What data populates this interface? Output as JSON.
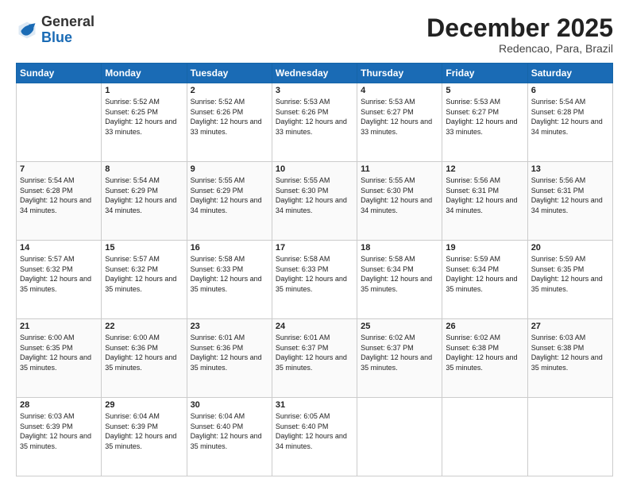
{
  "logo": {
    "general": "General",
    "blue": "Blue"
  },
  "header": {
    "title": "December 2025",
    "subtitle": "Redencao, Para, Brazil"
  },
  "days_of_week": [
    "Sunday",
    "Monday",
    "Tuesday",
    "Wednesday",
    "Thursday",
    "Friday",
    "Saturday"
  ],
  "weeks": [
    [
      {
        "day": "",
        "sunrise": "",
        "sunset": "",
        "daylight": ""
      },
      {
        "day": "1",
        "sunrise": "Sunrise: 5:52 AM",
        "sunset": "Sunset: 6:25 PM",
        "daylight": "Daylight: 12 hours and 33 minutes."
      },
      {
        "day": "2",
        "sunrise": "Sunrise: 5:52 AM",
        "sunset": "Sunset: 6:26 PM",
        "daylight": "Daylight: 12 hours and 33 minutes."
      },
      {
        "day": "3",
        "sunrise": "Sunrise: 5:53 AM",
        "sunset": "Sunset: 6:26 PM",
        "daylight": "Daylight: 12 hours and 33 minutes."
      },
      {
        "day": "4",
        "sunrise": "Sunrise: 5:53 AM",
        "sunset": "Sunset: 6:27 PM",
        "daylight": "Daylight: 12 hours and 33 minutes."
      },
      {
        "day": "5",
        "sunrise": "Sunrise: 5:53 AM",
        "sunset": "Sunset: 6:27 PM",
        "daylight": "Daylight: 12 hours and 33 minutes."
      },
      {
        "day": "6",
        "sunrise": "Sunrise: 5:54 AM",
        "sunset": "Sunset: 6:28 PM",
        "daylight": "Daylight: 12 hours and 34 minutes."
      }
    ],
    [
      {
        "day": "7",
        "sunrise": "Sunrise: 5:54 AM",
        "sunset": "Sunset: 6:28 PM",
        "daylight": "Daylight: 12 hours and 34 minutes."
      },
      {
        "day": "8",
        "sunrise": "Sunrise: 5:54 AM",
        "sunset": "Sunset: 6:29 PM",
        "daylight": "Daylight: 12 hours and 34 minutes."
      },
      {
        "day": "9",
        "sunrise": "Sunrise: 5:55 AM",
        "sunset": "Sunset: 6:29 PM",
        "daylight": "Daylight: 12 hours and 34 minutes."
      },
      {
        "day": "10",
        "sunrise": "Sunrise: 5:55 AM",
        "sunset": "Sunset: 6:30 PM",
        "daylight": "Daylight: 12 hours and 34 minutes."
      },
      {
        "day": "11",
        "sunrise": "Sunrise: 5:55 AM",
        "sunset": "Sunset: 6:30 PM",
        "daylight": "Daylight: 12 hours and 34 minutes."
      },
      {
        "day": "12",
        "sunrise": "Sunrise: 5:56 AM",
        "sunset": "Sunset: 6:31 PM",
        "daylight": "Daylight: 12 hours and 34 minutes."
      },
      {
        "day": "13",
        "sunrise": "Sunrise: 5:56 AM",
        "sunset": "Sunset: 6:31 PM",
        "daylight": "Daylight: 12 hours and 34 minutes."
      }
    ],
    [
      {
        "day": "14",
        "sunrise": "Sunrise: 5:57 AM",
        "sunset": "Sunset: 6:32 PM",
        "daylight": "Daylight: 12 hours and 35 minutes."
      },
      {
        "day": "15",
        "sunrise": "Sunrise: 5:57 AM",
        "sunset": "Sunset: 6:32 PM",
        "daylight": "Daylight: 12 hours and 35 minutes."
      },
      {
        "day": "16",
        "sunrise": "Sunrise: 5:58 AM",
        "sunset": "Sunset: 6:33 PM",
        "daylight": "Daylight: 12 hours and 35 minutes."
      },
      {
        "day": "17",
        "sunrise": "Sunrise: 5:58 AM",
        "sunset": "Sunset: 6:33 PM",
        "daylight": "Daylight: 12 hours and 35 minutes."
      },
      {
        "day": "18",
        "sunrise": "Sunrise: 5:58 AM",
        "sunset": "Sunset: 6:34 PM",
        "daylight": "Daylight: 12 hours and 35 minutes."
      },
      {
        "day": "19",
        "sunrise": "Sunrise: 5:59 AM",
        "sunset": "Sunset: 6:34 PM",
        "daylight": "Daylight: 12 hours and 35 minutes."
      },
      {
        "day": "20",
        "sunrise": "Sunrise: 5:59 AM",
        "sunset": "Sunset: 6:35 PM",
        "daylight": "Daylight: 12 hours and 35 minutes."
      }
    ],
    [
      {
        "day": "21",
        "sunrise": "Sunrise: 6:00 AM",
        "sunset": "Sunset: 6:35 PM",
        "daylight": "Daylight: 12 hours and 35 minutes."
      },
      {
        "day": "22",
        "sunrise": "Sunrise: 6:00 AM",
        "sunset": "Sunset: 6:36 PM",
        "daylight": "Daylight: 12 hours and 35 minutes."
      },
      {
        "day": "23",
        "sunrise": "Sunrise: 6:01 AM",
        "sunset": "Sunset: 6:36 PM",
        "daylight": "Daylight: 12 hours and 35 minutes."
      },
      {
        "day": "24",
        "sunrise": "Sunrise: 6:01 AM",
        "sunset": "Sunset: 6:37 PM",
        "daylight": "Daylight: 12 hours and 35 minutes."
      },
      {
        "day": "25",
        "sunrise": "Sunrise: 6:02 AM",
        "sunset": "Sunset: 6:37 PM",
        "daylight": "Daylight: 12 hours and 35 minutes."
      },
      {
        "day": "26",
        "sunrise": "Sunrise: 6:02 AM",
        "sunset": "Sunset: 6:38 PM",
        "daylight": "Daylight: 12 hours and 35 minutes."
      },
      {
        "day": "27",
        "sunrise": "Sunrise: 6:03 AM",
        "sunset": "Sunset: 6:38 PM",
        "daylight": "Daylight: 12 hours and 35 minutes."
      }
    ],
    [
      {
        "day": "28",
        "sunrise": "Sunrise: 6:03 AM",
        "sunset": "Sunset: 6:39 PM",
        "daylight": "Daylight: 12 hours and 35 minutes."
      },
      {
        "day": "29",
        "sunrise": "Sunrise: 6:04 AM",
        "sunset": "Sunset: 6:39 PM",
        "daylight": "Daylight: 12 hours and 35 minutes."
      },
      {
        "day": "30",
        "sunrise": "Sunrise: 6:04 AM",
        "sunset": "Sunset: 6:40 PM",
        "daylight": "Daylight: 12 hours and 35 minutes."
      },
      {
        "day": "31",
        "sunrise": "Sunrise: 6:05 AM",
        "sunset": "Sunset: 6:40 PM",
        "daylight": "Daylight: 12 hours and 34 minutes."
      },
      {
        "day": "",
        "sunrise": "",
        "sunset": "",
        "daylight": ""
      },
      {
        "day": "",
        "sunrise": "",
        "sunset": "",
        "daylight": ""
      },
      {
        "day": "",
        "sunrise": "",
        "sunset": "",
        "daylight": ""
      }
    ]
  ]
}
